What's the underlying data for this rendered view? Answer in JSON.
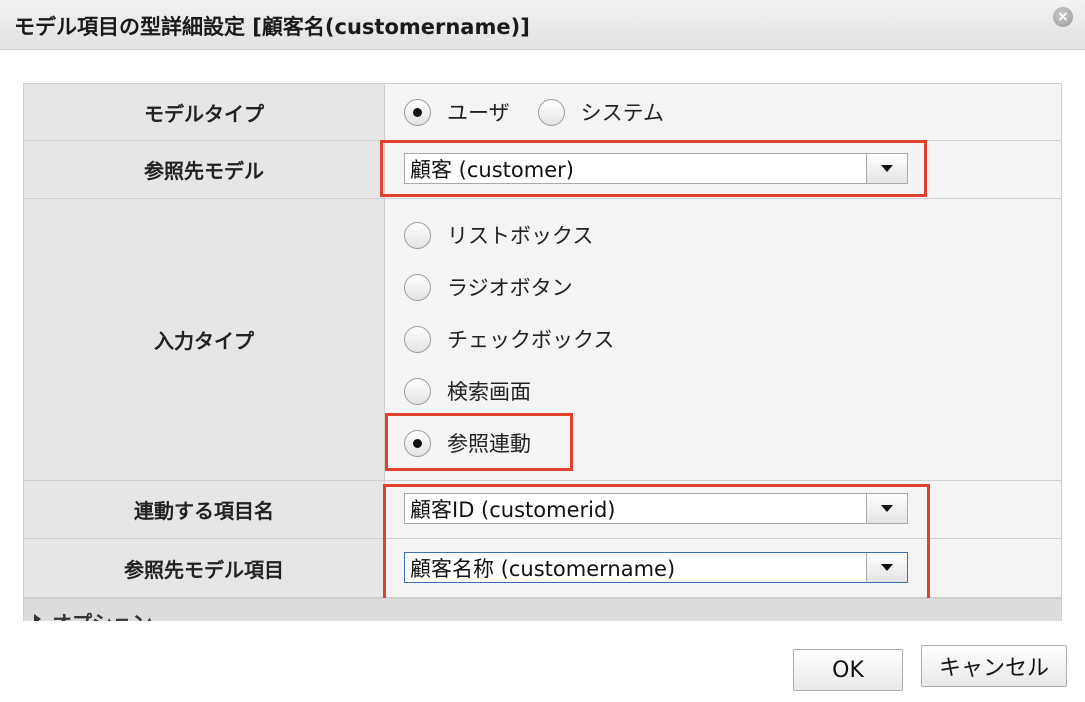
{
  "dialog": {
    "title": "モデル項目の型詳細設定 [顧客名(customername)]"
  },
  "form": {
    "model_type": {
      "label": "モデルタイプ",
      "options": [
        {
          "label": "ユーザ",
          "checked": true
        },
        {
          "label": "システム",
          "checked": false
        }
      ]
    },
    "ref_model": {
      "label": "参照先モデル",
      "value": "顧客 (customer)"
    },
    "input_type": {
      "label": "入力タイプ",
      "options": [
        {
          "label": "リストボックス",
          "checked": false
        },
        {
          "label": "ラジオボタン",
          "checked": false
        },
        {
          "label": "チェックボックス",
          "checked": false
        },
        {
          "label": "検索画面",
          "checked": false
        },
        {
          "label": "参照連動",
          "checked": true
        }
      ]
    },
    "linked_item": {
      "label": "連動する項目名",
      "value": "顧客ID (customerid)"
    },
    "ref_model_item": {
      "label": "参照先モデル項目",
      "value": "顧客名称 (customername)"
    }
  },
  "options_section": {
    "label": "オプション"
  },
  "buttons": {
    "ok": "OK",
    "cancel": "キャンセル"
  },
  "colors": {
    "highlight": "#e0412f",
    "label_bg": "#e6e6e6",
    "value_bg": "#f4f4f4"
  }
}
